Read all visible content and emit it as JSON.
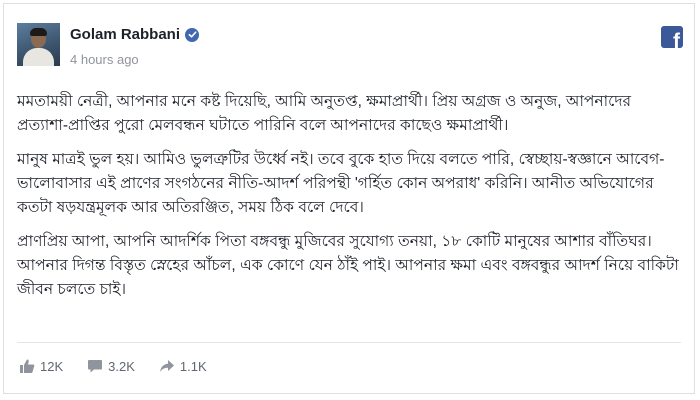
{
  "post": {
    "author": "Golam Rabbani",
    "timestamp": "4 hours ago",
    "paragraphs": [
      "মমতাময়ী নেত্রী, আপনার মনে কষ্ট দিয়েছি, আমি অনুতপ্ত, ক্ষমাপ্রার্থী। প্রিয় অগ্রজ ও অনুজ, আপনাদের প্রত্যাশা-প্রাপ্তির পুরো মেলবন্ধন ঘটাতে পারিনি বলে আপনাদের কাছেও ক্ষমাপ্রার্থী।",
      "মানুষ মাত্রই ভুল হয়। আমিও ভুলত্রুটির উর্ধ্বে নই। তবে বুকে হাত দিয়ে বলতে পারি, স্বেচ্ছায়-স্বজ্ঞানে আবেগ-ভালোবাসার এই প্রাণের সংগঠনের নীতি-আদর্শ পরিপন্থী 'গর্হিত কোন অপরাধ' করিনি। আনীত অভিযোগের কতটা ষড়যন্ত্রমূলক আর অতিরঞ্জিত, সময় ঠিক বলে দেবে।",
      "প্রাণপ্রিয় আপা, আপনি আদর্শিক পিতা বঙ্গবন্ধু মুজিবের সুযোগ্য তনয়া, ১৮ কোটি মানুষের আশার বাঁতিঘর। আপনার দিগন্ত বিস্তৃত স্নেহের আঁচল, এক কোণে যেন ঠাঁই পাই। আপনার ক্ষমা এবং বঙ্গবন্ধুর আদর্শ নিয়ে বাকিটা জীবন চলতে চাই।"
    ]
  },
  "stats": {
    "likes": "12K",
    "comments": "3.2K",
    "shares": "1.1K"
  },
  "icons": {
    "brand": "facebook-logo-icon",
    "verified": "verified-badge-icon",
    "like": "thumbs-up-icon",
    "comment": "comment-icon",
    "share": "share-arrow-icon"
  },
  "colors": {
    "brand": "#3b5998",
    "verified": "#4267b2",
    "muted": "#90949c"
  }
}
